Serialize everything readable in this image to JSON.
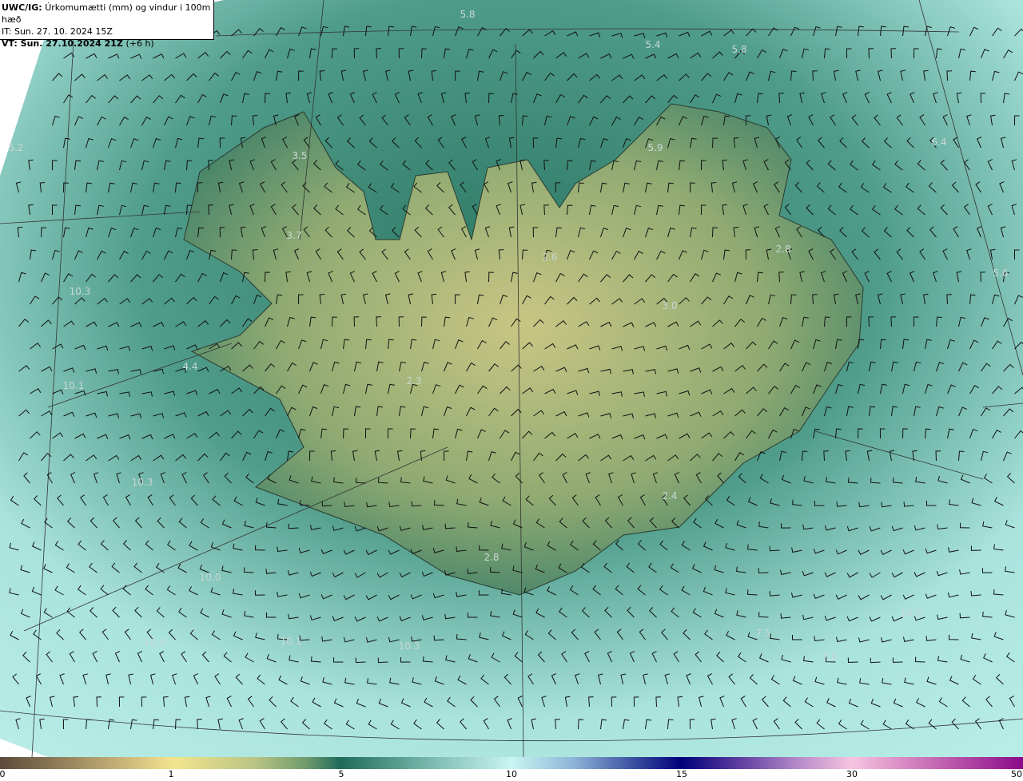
{
  "header": {
    "model": "UWC/IG:",
    "title": "Úrkomumætti (mm) og vindur i 100m hæð",
    "initial_time": "IT: Sun. 27. 10. 2024 15Z",
    "valid_label": "VT: Sun. 27.10.2024 21Z",
    "valid_offset": "(+6 h)"
  },
  "colorbar": {
    "ticks": [
      "0",
      "1",
      "5",
      "10",
      "15",
      "30",
      "50"
    ],
    "colors": [
      "#5c4a3a",
      "#f3e58e",
      "#1f6b5a",
      "#c9f5f2",
      "#00007a",
      "#f7c4e0",
      "#8a0a8a"
    ]
  },
  "map": {
    "sea_color": "#7fc7bf",
    "land_color": "#5f9a72",
    "labels": [
      "5.8",
      "5.4",
      "5.8",
      "5.2",
      "3.5",
      "5.9",
      "6.4",
      "3.7",
      "2.6",
      "2.8",
      "5.6",
      "10.3",
      "3.0",
      "4.4",
      "10.1",
      "2.3",
      "10.3",
      "2.4",
      "2.8",
      "10.0",
      "10.0",
      "10.1",
      "10.3",
      "7.5",
      "10.5",
      "7.6"
    ]
  }
}
